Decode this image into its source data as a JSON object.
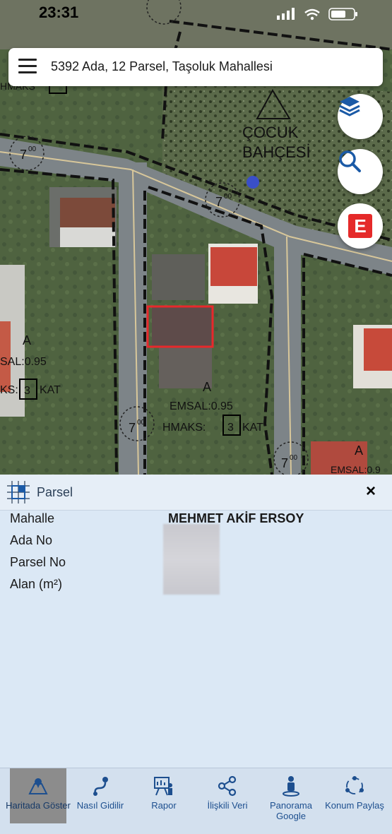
{
  "status_bar": {
    "time": "23:31"
  },
  "search_bar": {
    "title": "5392 Ada, 12 Parsel, Taşoluk Mahallesi"
  },
  "map": {
    "labels": {
      "park_line1": "ÇOCUK",
      "park_line2": "BAHÇESİ",
      "road_width": "7",
      "road_width_sup": "00",
      "zone_letter": "A",
      "emsal": "EMSAL:0.95",
      "emsal_left": "SAL:0.95",
      "hmaks_prefix": "HMAKS:",
      "hmaks_left_prefix": "KS:",
      "kat_count": "3",
      "kat_suffix": "KAT",
      "hmaks_top": "HMAKS",
      "emsal_right": "EMSAL:0.9"
    },
    "buttons": {
      "layers": "layers-icon",
      "search": "search-icon",
      "e_label": "E"
    },
    "colors": {
      "selected_parcel": "#e8282b",
      "e_button": "#e52a2a",
      "accent_blue": "#1b5aa6"
    }
  },
  "panel": {
    "title": "Parsel",
    "close": "×",
    "fields": [
      {
        "label": "Mahalle",
        "value": "MEHMET AKİF ERSOY"
      },
      {
        "label": "Ada No",
        "value": ""
      },
      {
        "label": "Parsel No",
        "value": ""
      },
      {
        "label": "Alan (m²)",
        "value": ""
      }
    ]
  },
  "tabs": [
    {
      "label": "Haritada Göster",
      "icon": "map-marker-icon",
      "active": true
    },
    {
      "label": "Nasıl Gidilir",
      "icon": "route-icon",
      "active": false
    },
    {
      "label": "Rapor",
      "icon": "report-icon",
      "active": false
    },
    {
      "label": "İlişkili Veri",
      "icon": "share-icon",
      "active": false
    },
    {
      "label": "Panorama Google",
      "icon": "pegman-icon",
      "active": false
    },
    {
      "label": "Konum Paylaş",
      "icon": "location-share-icon",
      "active": false
    }
  ]
}
